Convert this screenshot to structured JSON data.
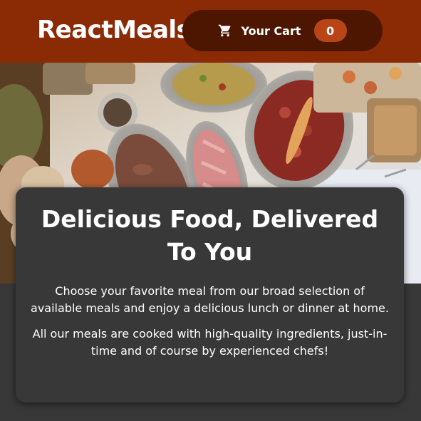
{
  "header": {
    "brand": "ReactMeals",
    "cart": {
      "label": "Your Cart",
      "count": "0",
      "icon": "cart-icon"
    }
  },
  "hero": {
    "image_alt": "A table full of delicious food!"
  },
  "summary": {
    "title": "Delicious Food, Delivered To You",
    "paragraph1": "Choose your favorite meal from our broad selection of available meals and enjoy a delicious lunch or dinner at home.",
    "paragraph2": "All our meals are cooked with high-quality ingredients, just-in-time and of course by experienced chefs!"
  },
  "colors": {
    "header_bg": "#8a2b06",
    "cart_button_bg": "#4d1601",
    "badge_bg": "#b94517",
    "page_bg": "#383838",
    "text": "#ffffff"
  }
}
